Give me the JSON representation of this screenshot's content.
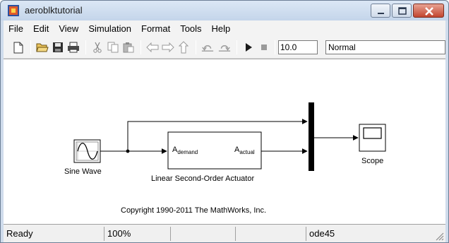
{
  "window": {
    "title": "aeroblktutorial"
  },
  "menu": [
    "File",
    "Edit",
    "View",
    "Simulation",
    "Format",
    "Tools",
    "Help"
  ],
  "toolbar": {
    "stop_time": "10.0",
    "sim_mode": "Normal",
    "icons": [
      "new-model-icon",
      "open-icon",
      "save-icon",
      "print-icon",
      "cut-icon",
      "copy-icon",
      "paste-icon",
      "back-icon",
      "forward-icon",
      "up-icon",
      "undo-icon",
      "redo-icon",
      "start-simulation-icon",
      "stop-simulation-icon"
    ]
  },
  "diagram": {
    "blocks": {
      "sine": "Sine Wave",
      "actuator": "Linear Second-Order Actuator",
      "scope": "Scope"
    },
    "port_in": {
      "main": "A",
      "sub": "demand"
    },
    "port_out": {
      "main": "A",
      "sub": "actual"
    },
    "copyright": "Copyright 1990-2011 The MathWorks, Inc."
  },
  "status": {
    "state": "Ready",
    "zoom": "100%",
    "blank1": "",
    "blank2": "",
    "solver": "ode45"
  }
}
